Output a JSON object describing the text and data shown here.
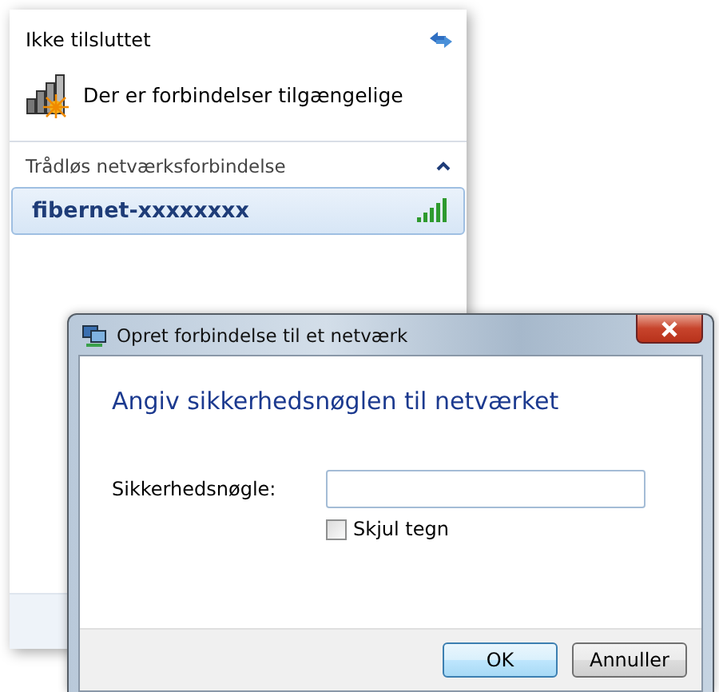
{
  "flyout": {
    "status": "Ikke tilsluttet",
    "info": "Der er forbindelser tilgængelige",
    "section": {
      "title": "Trådløs netværksforbindelse",
      "expanded": true
    },
    "networks": [
      {
        "name": "fibernet-xxxxxxxx",
        "selected": true
      }
    ]
  },
  "dialog": {
    "title": "Opret forbindelse til et netværk",
    "heading": "Angiv sikkerhedsnøglen til netværket",
    "field": {
      "label": "Sikkerhedsnøgle:"
    },
    "checkbox": {
      "label": "Skjul tegn",
      "checked": false
    },
    "buttons": [
      {
        "label": "OK",
        "default": true
      },
      {
        "label": "Annuller",
        "default": false
      }
    ]
  }
}
